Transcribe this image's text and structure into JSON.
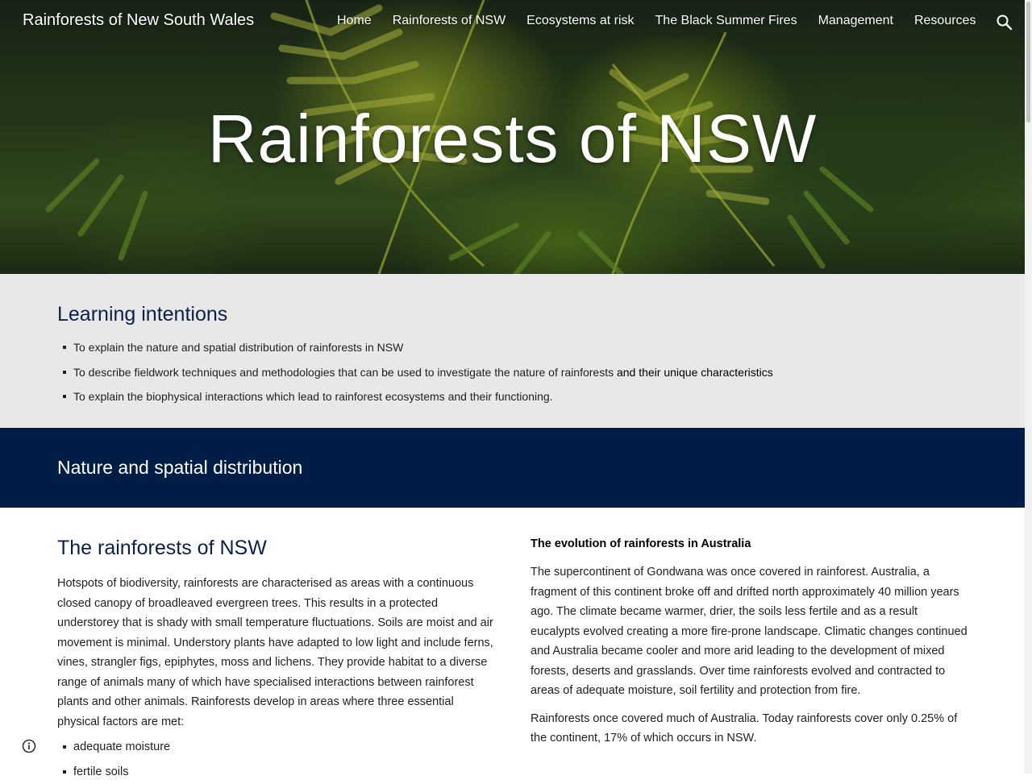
{
  "header": {
    "site_title": "Rainforests of New South Wales",
    "nav": [
      "Home",
      "Rainforests of NSW",
      "Ecosystems at risk",
      "The Black Summer Fires",
      "Management",
      "Resources"
    ],
    "search_icon": "search-icon"
  },
  "hero": {
    "title": "Rainforests of NSW"
  },
  "intentions": {
    "heading": "Learning intentions",
    "items": [
      {
        "text": "To explain the nature and spatial distribution of rainforests in NSW",
        "text_dark": ""
      },
      {
        "text": "To describe fieldwork techniques and methodologies that can be used to investigate the nature of rainforests ",
        "text_dark": "and their unique characteristics"
      },
      {
        "text": "To explain the biophysical interactions which lead to rainforest ecosystems and their functioning.",
        "text_dark": ""
      }
    ]
  },
  "banner": {
    "heading": "Nature and spatial distribution"
  },
  "left": {
    "heading": "The rainforests of NSW",
    "paragraph": "Hotspots of biodiversity, rainforests are characterised as areas with a continuous closed canopy of broadleaved evergreen trees. This results in a protected understorey that is shady with small temperature fluctuations. Soils are moist and air movement is minimal. Understory plants have adapted to low light and include ferns, vines, strangler figs, epiphytes, moss and lichens.  They provide habitat to a diverse range of animals many of which have specialised interactions between rainforest plants and other animals.  Rainforests develop in areas where three essential physical factors are met:",
    "factors": [
      "adequate moisture",
      "fertile soils"
    ]
  },
  "right": {
    "heading": "The evolution of rainforests in Australia",
    "paragraphs": [
      "The supercontinent of Gondwana was once covered in rainforest. Australia, a fragment of this continent broke off and drifted north approximately 40 million years ago. The climate became warmer, drier, the soils less fertile and as a result eucalypts evolved creating a more fire-prone landscape. Climatic changes continued and Australia became cooler and more arid leading to the development of mixed forests, deserts and grasslands. Over time rainforests evolved and contracted to areas of adequate moisture, soil fertility and protection from fire.",
      "Rainforests once covered much of Australia. Today rainforests cover only 0.25% of the continent, 17% of which occurs in NSW."
    ]
  },
  "colors": {
    "banner_bg": "#001e45",
    "heading_navy": "#0c2149",
    "intentions_bg": "#e8e8e8"
  },
  "icons": {
    "info": "info-icon"
  }
}
